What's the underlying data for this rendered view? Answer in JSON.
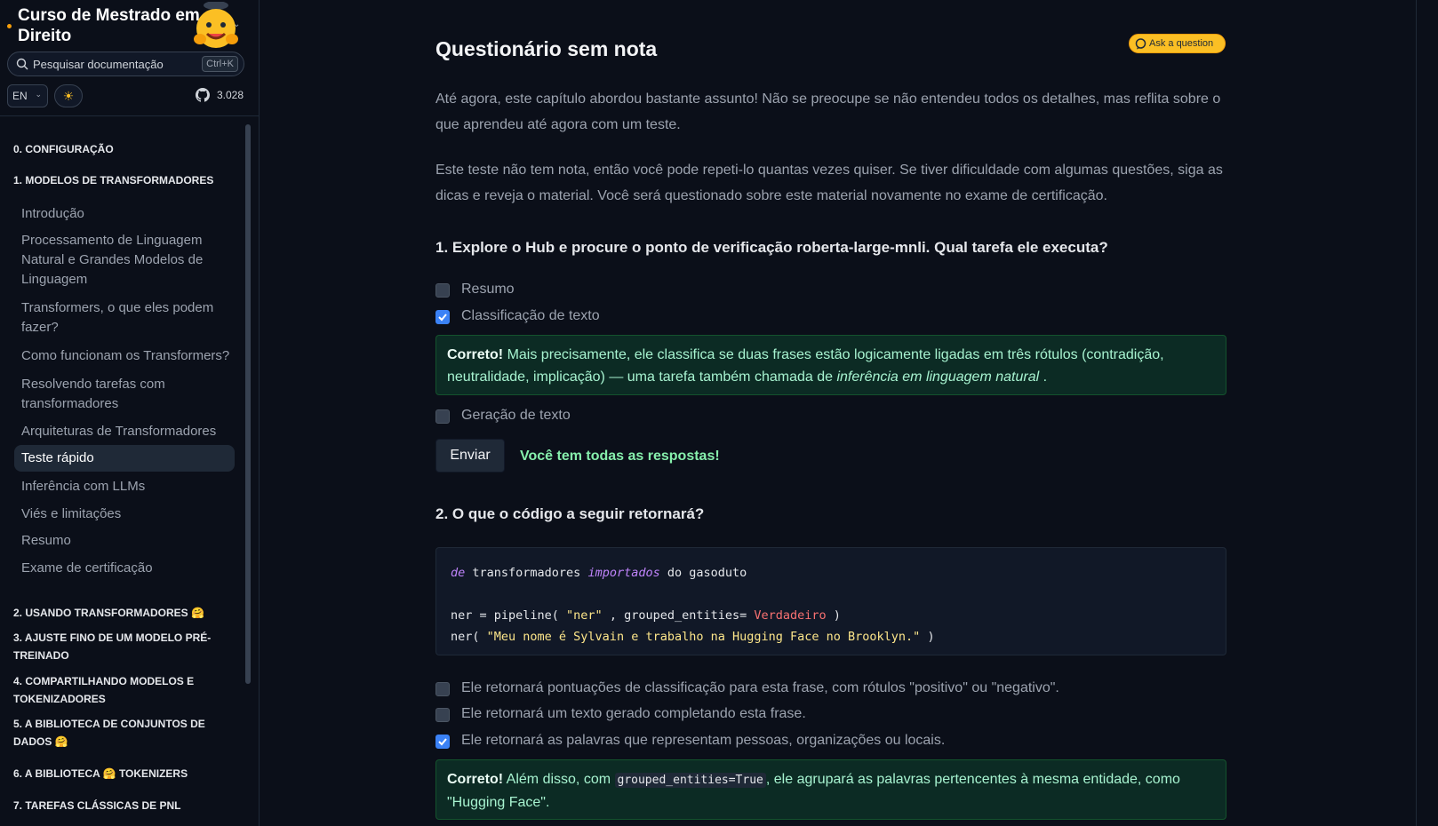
{
  "sidebar": {
    "brand_title": "Curso de Mestrado em Direito",
    "search_placeholder": "Pesquisar documentação",
    "search_shortcut": "Ctrl+K",
    "lang": "EN",
    "github_count": "3.028",
    "sections": [
      "0. CONFIGURAÇÃO",
      "1. MODELOS DE TRANSFORMADORES",
      "2. USANDO TRANSFORMADORES 🤗",
      "3. AJUSTE FINO DE UM MODELO PRÉ-TREINADO",
      "4. COMPARTILHANDO MODELOS E TOKENIZADORES",
      "5. A BIBLIOTECA DE CONJUNTOS DE DADOS 🤗",
      "6. A BIBLIOTECA 🤗 TOKENIZERS",
      "7. TAREFAS CLÁSSICAS DE PNL"
    ],
    "items": [
      "Introdução",
      "Processamento de Linguagem Natural e Grandes Modelos de Linguagem",
      "Transformers, o que eles podem fazer?",
      "Como funcionam os Transformers?",
      "Resolvendo tarefas com transformadores",
      "Arquiteturas de Transformadores",
      "Teste rápido",
      "Inferência com LLMs",
      "Viés e limitações",
      "Resumo",
      "Exame de certificação"
    ]
  },
  "main": {
    "title": "Questionário sem nota",
    "ask_label": "Ask a question",
    "intro_1": "Até agora, este capítulo abordou bastante assunto! Não se preocupe se não entendeu todos os detalhes, mas reflita sobre o que aprendeu até agora com um teste.",
    "intro_2": "Este teste não tem nota, então você pode repeti-lo quantas vezes quiser. Se tiver dificuldade com algumas questões, siga as dicas e reveja o material. Você será questionado sobre este material novamente no exame de certificação.",
    "q1": {
      "question": "1. Explore o Hub e procure o ponto de verificação roberta-large-mnli. Qual tarefa ele executa?",
      "options": [
        "Resumo",
        "Classificação de texto",
        "Geração de texto"
      ],
      "feedback_label": "Correto!",
      "feedback_text": "Mais precisamente, ele classifica se duas frases estão logicamente ligadas em três rótulos (contradição, neutralidade, implicação) — uma tarefa também chamada de",
      "feedback_em": "inferência em linguagem natural",
      "feedback_end": ".",
      "submit_label": "Enviar",
      "result": "Você tem todas as respostas!"
    },
    "q2": {
      "question": "2. O que o código a seguir retornará?",
      "code": {
        "l1_kw1": "de",
        "l1_mod": " transformadores ",
        "l1_kw2": "importados",
        "l1_rest": " do gasoduto",
        "l3_a": "ner = pipeline( ",
        "l3_str": "\"ner\"",
        "l3_b": " , grouped_entities= ",
        "l3_bool": "Verdadeiro",
        "l3_c": " )",
        "l4_a": "ner( ",
        "l4_str": "\"Meu nome é Sylvain e trabalho na Hugging Face no Brooklyn.\"",
        "l4_b": " )"
      },
      "options": [
        "Ele retornará pontuações de classificação para esta frase, com rótulos \"positivo\" ou \"negativo\".",
        "Ele retornará um texto gerado completando esta frase.",
        "Ele retornará as palavras que representam pessoas, organizações ou locais."
      ],
      "feedback_label": "Correto!",
      "feedback_a": "Além disso, com",
      "feedback_code": "grouped_entities=True",
      "feedback_b": ", ele agrupará as palavras pertencentes à mesma entidade, como \"Hugging Face\"."
    }
  },
  "colors": {
    "accent": "#3b82f6",
    "correct_bg": "#0c2b24",
    "correct_text": "#86efac",
    "brand_dot": "#f59e0b"
  }
}
